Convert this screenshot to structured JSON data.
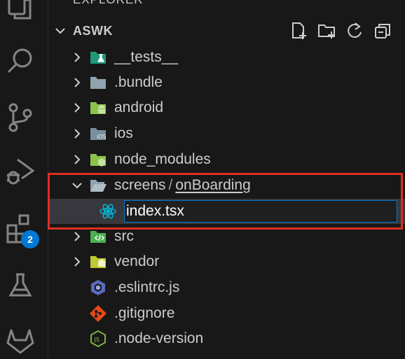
{
  "activity_bar": {
    "icons": [
      "files-icon",
      "search-icon",
      "source-control-icon",
      "run-debug-icon",
      "extensions-icon",
      "testing-icon",
      "gitlab-icon"
    ],
    "extensions_badge": "2"
  },
  "explorer": {
    "title": "EXPLORER",
    "section_title": "ASWK",
    "actions": [
      "new-file-icon",
      "new-folder-icon",
      "refresh-icon",
      "collapse-all-icon"
    ]
  },
  "tree": {
    "tests": "__tests__",
    "bundle": ".bundle",
    "android": "android",
    "ios": "ios",
    "node_modules": "node_modules",
    "screens": "screens",
    "separator": "/",
    "onboarding": "onBoarding",
    "rename_value": "index.tsx",
    "src": "src",
    "vendor": "vendor",
    "eslintrc": ".eslintrc.js",
    "gitignore": ".gitignore",
    "node_version": ".node-version"
  },
  "colors": {
    "accent": "#0078d4",
    "highlight": "#e02f20",
    "selection": "#37373d"
  }
}
